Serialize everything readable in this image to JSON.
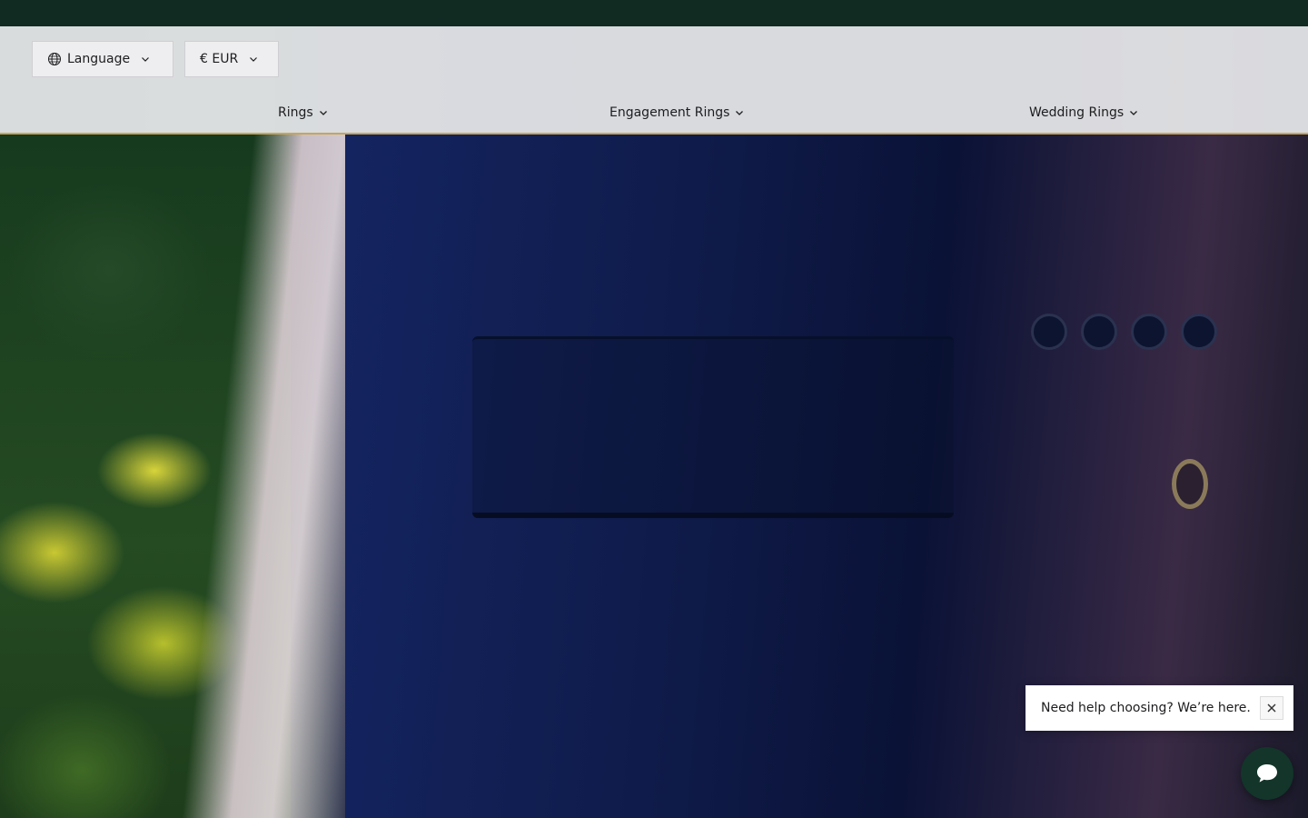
{
  "header": {
    "language_selector": {
      "label": "Language",
      "icon": "globe-icon"
    },
    "currency_selector": {
      "label": "€ EUR"
    }
  },
  "nav": {
    "items": [
      {
        "label": "Rings"
      },
      {
        "label": "Engagement Rings"
      },
      {
        "label": "Wedding Rings"
      }
    ]
  },
  "help_widget": {
    "message": "Need help choosing? We’re here.",
    "close_icon": "close-icon",
    "chat_icon": "chat-bubble-icon"
  },
  "colors": {
    "top_bar": "#122b22",
    "header_bg": "#e8e9ec",
    "header_border": "#c7a55a",
    "chat_button": "#13352a"
  }
}
